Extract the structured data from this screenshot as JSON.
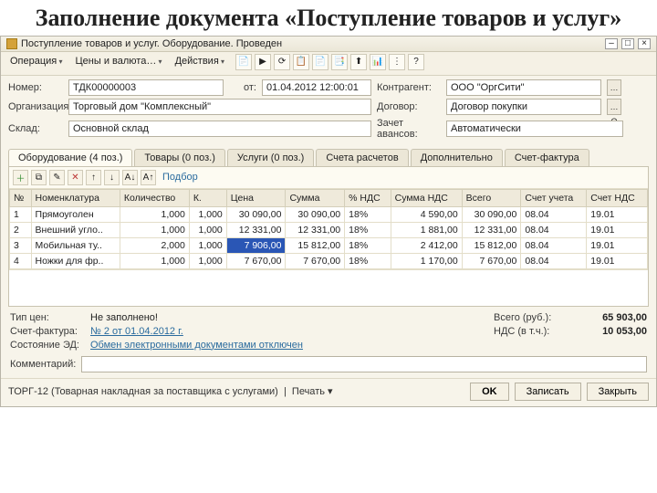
{
  "slide_title": "Заполнение документа «Поступление товаров и услуг»",
  "window": {
    "title": "Поступление товаров и услуг. Оборудование. Проведен"
  },
  "menu": {
    "operation": "Операция",
    "prices": "Цены и валюта…",
    "actions": "Действия"
  },
  "form": {
    "number_lbl": "Номер:",
    "number": "ТДК00000003",
    "date_lbl": "от:",
    "date": "01.04.2012 12:00:01",
    "contragent_lbl": "Контрагент:",
    "contragent": "ООО \"ОргСити\"",
    "org_lbl": "Организация:",
    "org": "Торговый дом \"Комплексный\"",
    "contract_lbl": "Договор:",
    "contract": "Договор покупки",
    "sklad_lbl": "Склад:",
    "sklad": "Основной склад",
    "zachet_lbl": "Зачет авансов:",
    "zachet": "Автоматически"
  },
  "tabs": [
    "Оборудование (4 поз.)",
    "Товары (0 поз.)",
    "Услуги (0 поз.)",
    "Счета расчетов",
    "Дополнительно",
    "Счет-фактура"
  ],
  "rowbar": {
    "pick": "Подбор"
  },
  "grid": {
    "headers": [
      "№",
      "Номенклатура",
      "Количество",
      "К.",
      "Цена",
      "Сумма",
      "% НДС",
      "Сумма НДС",
      "Всего",
      "Счет учета",
      "Счет НДС"
    ],
    "rows": [
      {
        "n": "1",
        "nom": "Прямоуголен",
        "qty": "1,000",
        "k": "1,000",
        "price": "30 090,00",
        "sum": "30 090,00",
        "nds": "18%",
        "sumnds": "4 590,00",
        "total": "30 090,00",
        "acc": "08.04",
        "accnds": "19.01"
      },
      {
        "n": "2",
        "nom": "Внешний угло..",
        "qty": "1,000",
        "k": "1,000",
        "price": "12 331,00",
        "sum": "12 331,00",
        "nds": "18%",
        "sumnds": "1 881,00",
        "total": "12 331,00",
        "acc": "08.04",
        "accnds": "19.01"
      },
      {
        "n": "3",
        "nom": "Мобильная ту..",
        "qty": "2,000",
        "k": "1,000",
        "price": "7 906,00",
        "sum": "15 812,00",
        "nds": "18%",
        "sumnds": "2 412,00",
        "total": "15 812,00",
        "acc": "08.04",
        "accnds": "19.01"
      },
      {
        "n": "4",
        "nom": "Ножки для фр..",
        "qty": "1,000",
        "k": "1,000",
        "price": "7 670,00",
        "sum": "7 670,00",
        "nds": "18%",
        "sumnds": "1 170,00",
        "total": "7 670,00",
        "acc": "08.04",
        "accnds": "19.01"
      }
    ]
  },
  "bottom": {
    "pricetype_lbl": "Тип цен:",
    "pricetype": "Не заполнено!",
    "total_lbl": "Всего (руб.):",
    "total": "65 903,00",
    "sf_lbl": "Счет-фактура:",
    "sf": "№ 2 от 01.04.2012 г.",
    "ndstotal_lbl": "НДС (в т.ч.):",
    "ndstotal": "10 053,00",
    "ed_lbl": "Состояние ЭД:",
    "ed": "Обмен электронными документами отключен",
    "comment_lbl": "Комментарий:",
    "comment": ""
  },
  "footer": {
    "torg": "ТОРГ-12 (Товарная накладная за поставщика с услугами)",
    "print": "Печать",
    "ok": "OK",
    "save": "Записать",
    "close": "Закрыть"
  },
  "chart_data": {
    "type": "table",
    "title": "Оборудование",
    "columns": [
      "№",
      "Номенклатура",
      "Количество",
      "К.",
      "Цена",
      "Сумма",
      "% НДС",
      "Сумма НДС",
      "Всего",
      "Счет учета",
      "Счет НДС"
    ],
    "rows": [
      [
        1,
        "Прямоуголен",
        1.0,
        1.0,
        30090.0,
        30090.0,
        "18%",
        4590.0,
        30090.0,
        "08.04",
        "19.01"
      ],
      [
        2,
        "Внешний угло..",
        1.0,
        1.0,
        12331.0,
        12331.0,
        "18%",
        1881.0,
        12331.0,
        "08.04",
        "19.01"
      ],
      [
        3,
        "Мобильная ту..",
        2.0,
        1.0,
        7906.0,
        15812.0,
        "18%",
        2412.0,
        15812.0,
        "08.04",
        "19.01"
      ],
      [
        4,
        "Ножки для фр..",
        1.0,
        1.0,
        7670.0,
        7670.0,
        "18%",
        1170.0,
        7670.0,
        "08.04",
        "19.01"
      ]
    ],
    "totals": {
      "Всего (руб.)": 65903.0,
      "НДС (в т.ч.)": 10053.0
    }
  }
}
